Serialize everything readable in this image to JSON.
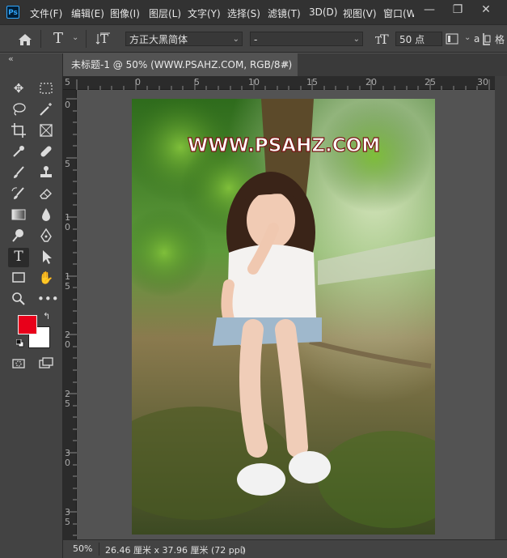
{
  "app": {
    "logo_text": "Ps"
  },
  "menu": [
    "文件(F)",
    "编辑(E)",
    "图像(I)",
    "图层(L)",
    "文字(Y)",
    "选择(S)",
    "滤镜(T)",
    "3D(D)",
    "视图(V)",
    "窗口(W"
  ],
  "window_controls": {
    "minimize": "—",
    "restore": "❐",
    "close": "✕"
  },
  "options": {
    "font_family": "方正大黑简体",
    "font_style": "-",
    "font_size": "50 点",
    "aa_partial": "a",
    "panel_collapse": "«",
    "right_clip": "格"
  },
  "document": {
    "tab_title": "未标题-1 @ 50% (WWW.PSAHZ.COM, RGB/8#) *",
    "close": "✕",
    "watermark_text": "WWW.PSAHZ.COM"
  },
  "rulers": {
    "horizontal": [
      "5",
      "0",
      "5",
      "10",
      "15",
      "20",
      "25",
      "30"
    ],
    "vertical": [
      [
        "0"
      ],
      [
        "5"
      ],
      [
        "1",
        "0"
      ],
      [
        "1",
        "5"
      ],
      [
        "2",
        "0"
      ],
      [
        "2",
        "5"
      ],
      [
        "3",
        "0"
      ],
      [
        "3",
        "5"
      ]
    ]
  },
  "status": {
    "zoom": "50%",
    "doc_size": "26.46 厘米 x 37.96 厘米 (72 ppi)",
    "arrow": "〉"
  },
  "colors": {
    "foreground": "#e8001a",
    "background": "#ffffff",
    "accent": "#31a8ff"
  },
  "icons": [
    "home-icon",
    "text-tool-icon",
    "vertical-text-icon",
    "text-size-icon",
    "paragraph-icon",
    "move-icon",
    "marquee-icon",
    "lasso-icon",
    "magic-wand-icon",
    "crop-icon",
    "frame-icon",
    "eyedropper-icon",
    "healing-icon",
    "brush-icon",
    "stamp-icon",
    "history-brush-icon",
    "eraser-icon",
    "gradient-icon",
    "blur-icon",
    "dodge-icon",
    "pen-icon",
    "type-icon",
    "path-select-icon",
    "rectangle-icon",
    "hand-icon",
    "zoom-icon",
    "more-icon",
    "swap-colors-icon",
    "default-colors-icon",
    "quick-mask-icon",
    "screen-mode-icon"
  ]
}
